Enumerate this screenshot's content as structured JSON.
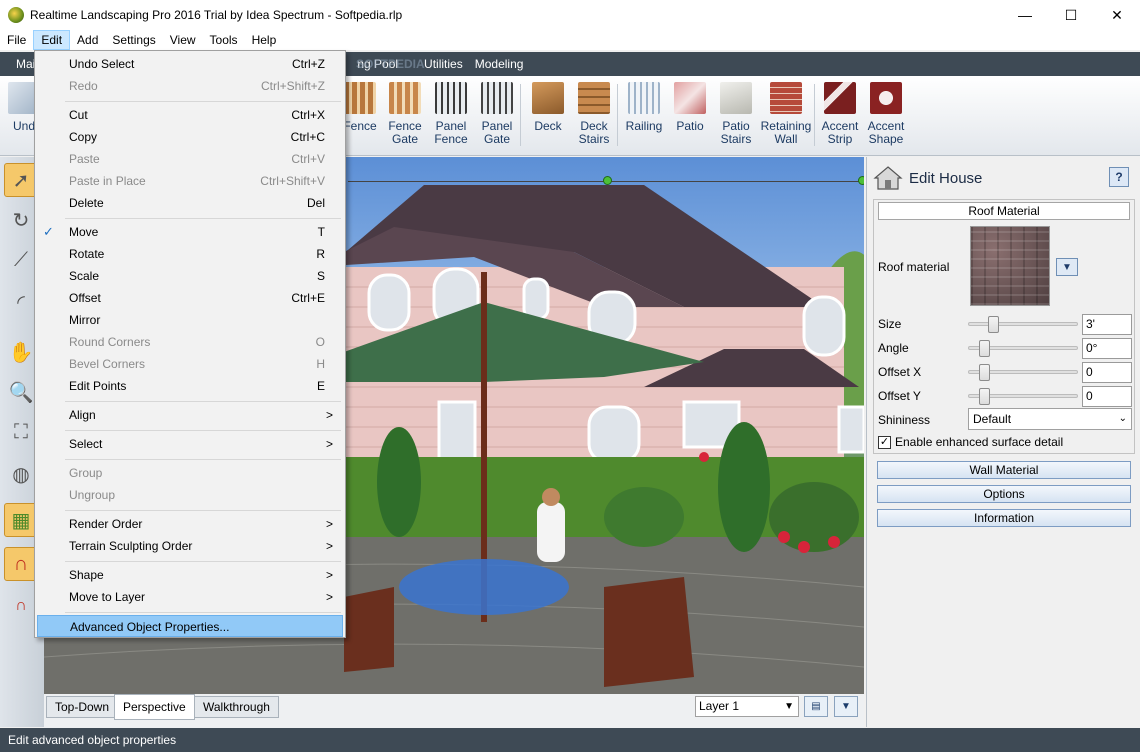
{
  "window": {
    "title": "Realtime Landscaping Pro 2016 Trial by Idea Spectrum - Softpedia.rlp",
    "controls": [
      "—",
      "☐",
      "✕"
    ]
  },
  "menubar": [
    "File",
    "Edit",
    "Add",
    "Settings",
    "View",
    "Tools",
    "Help"
  ],
  "ribbon_tabs": [
    "Mai",
    "ng Pool",
    "Utilities",
    "Modeling"
  ],
  "watermark": "SOFTPEDIA",
  "toolbar": {
    "left_tool": "Und",
    "items": [
      {
        "label": "Fence",
        "line2": ""
      },
      {
        "label": "Fence",
        "line2": "Gate"
      },
      {
        "label": "Panel",
        "line2": "Fence"
      },
      {
        "label": "Panel",
        "line2": "Gate"
      },
      {
        "label": "Deck",
        "line2": ""
      },
      {
        "label": "Deck",
        "line2": "Stairs"
      },
      {
        "label": "Railing",
        "line2": ""
      },
      {
        "label": "Patio",
        "line2": ""
      },
      {
        "label": "Patio",
        "line2": "Stairs"
      },
      {
        "label": "Retaining",
        "line2": "Wall"
      },
      {
        "label": "Accent",
        "line2": "Strip"
      },
      {
        "label": "Accent",
        "line2": "Shape"
      }
    ]
  },
  "edit_menu": {
    "items": [
      {
        "label": "Undo Select",
        "shortcut": "Ctrl+Z",
        "disabled": false
      },
      {
        "label": "Redo",
        "shortcut": "Ctrl+Shift+Z",
        "disabled": true
      },
      {
        "label": "Cut",
        "shortcut": "Ctrl+X",
        "disabled": false
      },
      {
        "label": "Copy",
        "shortcut": "Ctrl+C",
        "disabled": false
      },
      {
        "label": "Paste",
        "shortcut": "Ctrl+V",
        "disabled": true
      },
      {
        "label": "Paste in Place",
        "shortcut": "Ctrl+Shift+V",
        "disabled": true
      },
      {
        "label": "Delete",
        "shortcut": "Del",
        "disabled": false
      },
      {
        "label": "Move",
        "shortcut": "T",
        "disabled": false,
        "checked": true
      },
      {
        "label": "Rotate",
        "shortcut": "R",
        "disabled": false
      },
      {
        "label": "Scale",
        "shortcut": "S",
        "disabled": false
      },
      {
        "label": "Offset",
        "shortcut": "Ctrl+E",
        "disabled": false
      },
      {
        "label": "Mirror",
        "shortcut": "",
        "disabled": false
      },
      {
        "label": "Round Corners",
        "shortcut": "O",
        "disabled": true
      },
      {
        "label": "Bevel Corners",
        "shortcut": "H",
        "disabled": true
      },
      {
        "label": "Edit Points",
        "shortcut": "E",
        "disabled": false
      },
      {
        "label": "Align",
        "submenu": true
      },
      {
        "label": "Select",
        "submenu": true
      },
      {
        "label": "Group",
        "disabled": true
      },
      {
        "label": "Ungroup",
        "disabled": true
      },
      {
        "label": "Render Order",
        "submenu": true
      },
      {
        "label": "Terrain Sculpting Order",
        "submenu": true
      },
      {
        "label": "Shape",
        "submenu": true
      },
      {
        "label": "Move to Layer",
        "submenu": true
      },
      {
        "label": "Advanced Object Properties...",
        "highlighted": true
      }
    ],
    "checkmark": "✓",
    "submenu_arrow": ">"
  },
  "viewport": {
    "tabs": [
      "Top-Down",
      "Perspective",
      "Walkthrough"
    ],
    "selected_tab": "Perspective",
    "layer": "Layer 1"
  },
  "panel": {
    "title": "Edit House",
    "help": "?",
    "section": "Roof Material",
    "roof_material_label": "Roof material",
    "props": [
      {
        "label": "Size",
        "value": "3'",
        "level": 0.2
      },
      {
        "label": "Angle",
        "value": "0°",
        "level": 0.1
      },
      {
        "label": "Offset X",
        "value": "0",
        "level": 0.1
      },
      {
        "label": "Offset Y",
        "value": "0",
        "level": 0.1
      }
    ],
    "shininess_label": "Shininess",
    "shininess_value": "Default",
    "enhanced_label": "Enable enhanced surface detail",
    "enhanced_checked": true,
    "buttons": [
      "Wall Material",
      "Options",
      "Information"
    ]
  },
  "status": "Edit advanced object properties"
}
